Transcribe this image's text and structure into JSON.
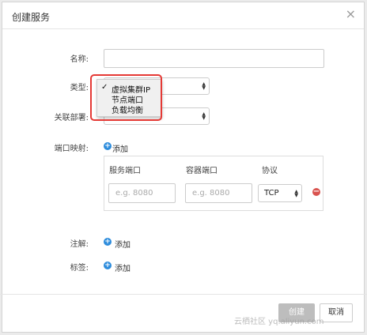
{
  "dialog": {
    "title": "创建服务",
    "close_glyph": "×"
  },
  "form": {
    "name_label": "名称:",
    "type_label": "类型:",
    "deployment_label": "关联部署:",
    "port_mapping_label": "端口映射:",
    "add_label": "添加",
    "annotation_label": "注解:",
    "annotation_add": "添加",
    "tag_label": "标签:",
    "tag_add": "添加"
  },
  "type_dropdown": {
    "options": [
      "虚拟集群IP",
      "节点端口",
      "负载均衡"
    ],
    "selected_index": 0,
    "check_glyph": "✓"
  },
  "ports": {
    "col_service_port": "服务端口",
    "col_container_port": "容器端口",
    "col_protocol": "协议",
    "service_port_placeholder": "e.g. 8080",
    "container_port_placeholder": "e.g. 8080",
    "protocol_value": "TCP"
  },
  "footer": {
    "create_label": "创建",
    "cancel_label": "取消"
  },
  "watermark": "云栖社区 yq.aliyun.com",
  "colors": {
    "accent": "#2d8cdc",
    "danger": "#d9534f",
    "highlight": "#e53935"
  }
}
